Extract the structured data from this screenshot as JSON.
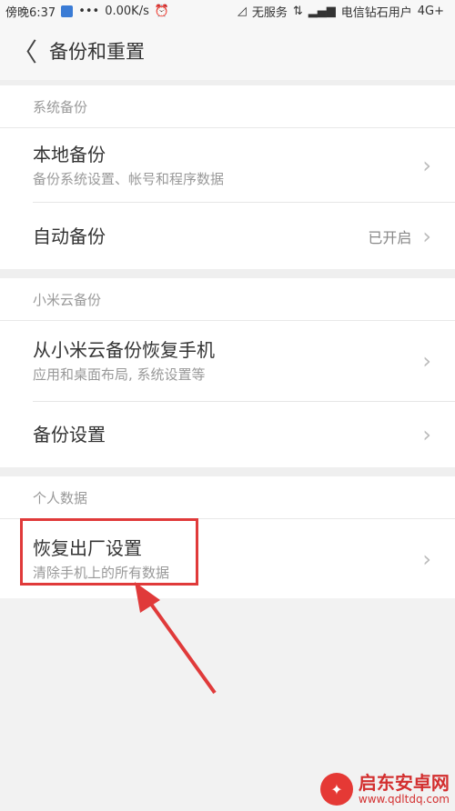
{
  "status_bar": {
    "time": "傍晚6:37",
    "dots": "•••",
    "speed": "0.00K/s",
    "alarm_icon": "⏰",
    "no_service": "无服务",
    "carrier": "电信钻石用户",
    "network": "4G+"
  },
  "toolbar": {
    "back_glyph": "〈",
    "title": "备份和重置"
  },
  "sections": [
    {
      "header": "系统备份",
      "rows": [
        {
          "title": "本地备份",
          "subtitle": "备份系统设置、帐号和程序数据",
          "value": ""
        },
        {
          "title": "自动备份",
          "subtitle": "",
          "value": "已开启"
        }
      ]
    },
    {
      "header": "小米云备份",
      "rows": [
        {
          "title": "从小米云备份恢复手机",
          "subtitle": "应用和桌面布局, 系统设置等",
          "value": ""
        },
        {
          "title": "备份设置",
          "subtitle": "",
          "value": ""
        }
      ]
    },
    {
      "header": "个人数据",
      "rows": [
        {
          "title": "恢复出厂设置",
          "subtitle": "清除手机上的所有数据",
          "value": ""
        }
      ]
    }
  ],
  "chevron": "›",
  "colors": {
    "highlight": "#e03a3a",
    "watermark": "#d32f2f"
  },
  "watermark": {
    "name": "启东安卓网",
    "url": "www.qdltdq.com"
  }
}
